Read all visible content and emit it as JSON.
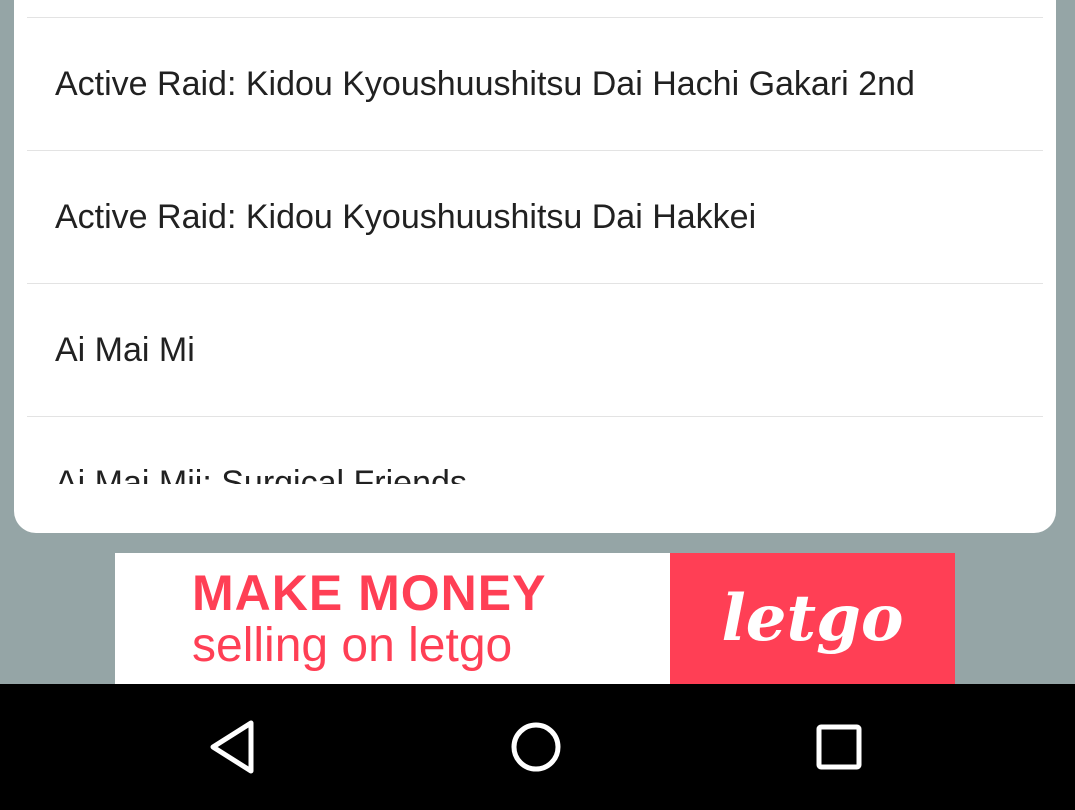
{
  "list": {
    "items": [
      {
        "label": "Active Raid: Kidou Kyoushuushitsu Dai Hachi Gakari 2nd"
      },
      {
        "label": "Active Raid: Kidou Kyoushuushitsu Dai Hakkei"
      },
      {
        "label": "Ai Mai Mi"
      },
      {
        "label": "Ai Mai Mii: Surgical Friends"
      }
    ]
  },
  "ad": {
    "headline": "MAKE MONEY",
    "subline": "selling on letgo",
    "logo": "letgo",
    "colors": {
      "brand": "#ff3f55"
    }
  },
  "navbar": {
    "back_icon": "back-triangle-icon",
    "home_icon": "home-circle-icon",
    "recents_icon": "recents-square-icon"
  }
}
